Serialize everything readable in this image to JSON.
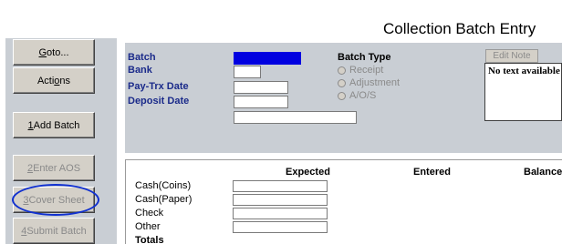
{
  "window": {
    "title": "Collection Batch Entry"
  },
  "left_buttons": [
    {
      "label_pre": "",
      "label_ul": "G",
      "label_post": "oto...",
      "enabled": true
    },
    {
      "label_pre": "Acti",
      "label_ul": "o",
      "label_post": "ns",
      "enabled": true
    },
    {
      "label_pre": "",
      "label_ul": "1",
      "label_post": " Add Batch",
      "enabled": true
    },
    {
      "label_pre": "",
      "label_ul": "2",
      "label_post": " Enter AOS",
      "enabled": false
    },
    {
      "label_pre": "",
      "label_ul": "3",
      "label_post": " Cover Sheet",
      "enabled": false
    },
    {
      "label_pre": "",
      "label_ul": "4",
      "label_post": " Submit Batch",
      "enabled": false
    }
  ],
  "form": {
    "batch_label": "Batch",
    "bank_label": "Bank",
    "paytrx_label": "Pay-Trx Date",
    "deposit_label": "Deposit Date",
    "batch_value": "",
    "bank_value": "",
    "paytrx_value": "",
    "deposit_value": "",
    "extra_value": ""
  },
  "batch_type": {
    "title": "Batch Type",
    "options": [
      "Receipt",
      "Adjustment",
      "A/O/S"
    ]
  },
  "note": {
    "edit_label": "Edit Note",
    "text": "No text available"
  },
  "amounts": {
    "headers": {
      "expected": "Expected",
      "entered": "Entered",
      "balance": "Balance"
    },
    "rows": [
      "Cash(Coins)",
      "Cash(Paper)",
      "Check",
      "Other"
    ],
    "totals_label": "Totals"
  }
}
